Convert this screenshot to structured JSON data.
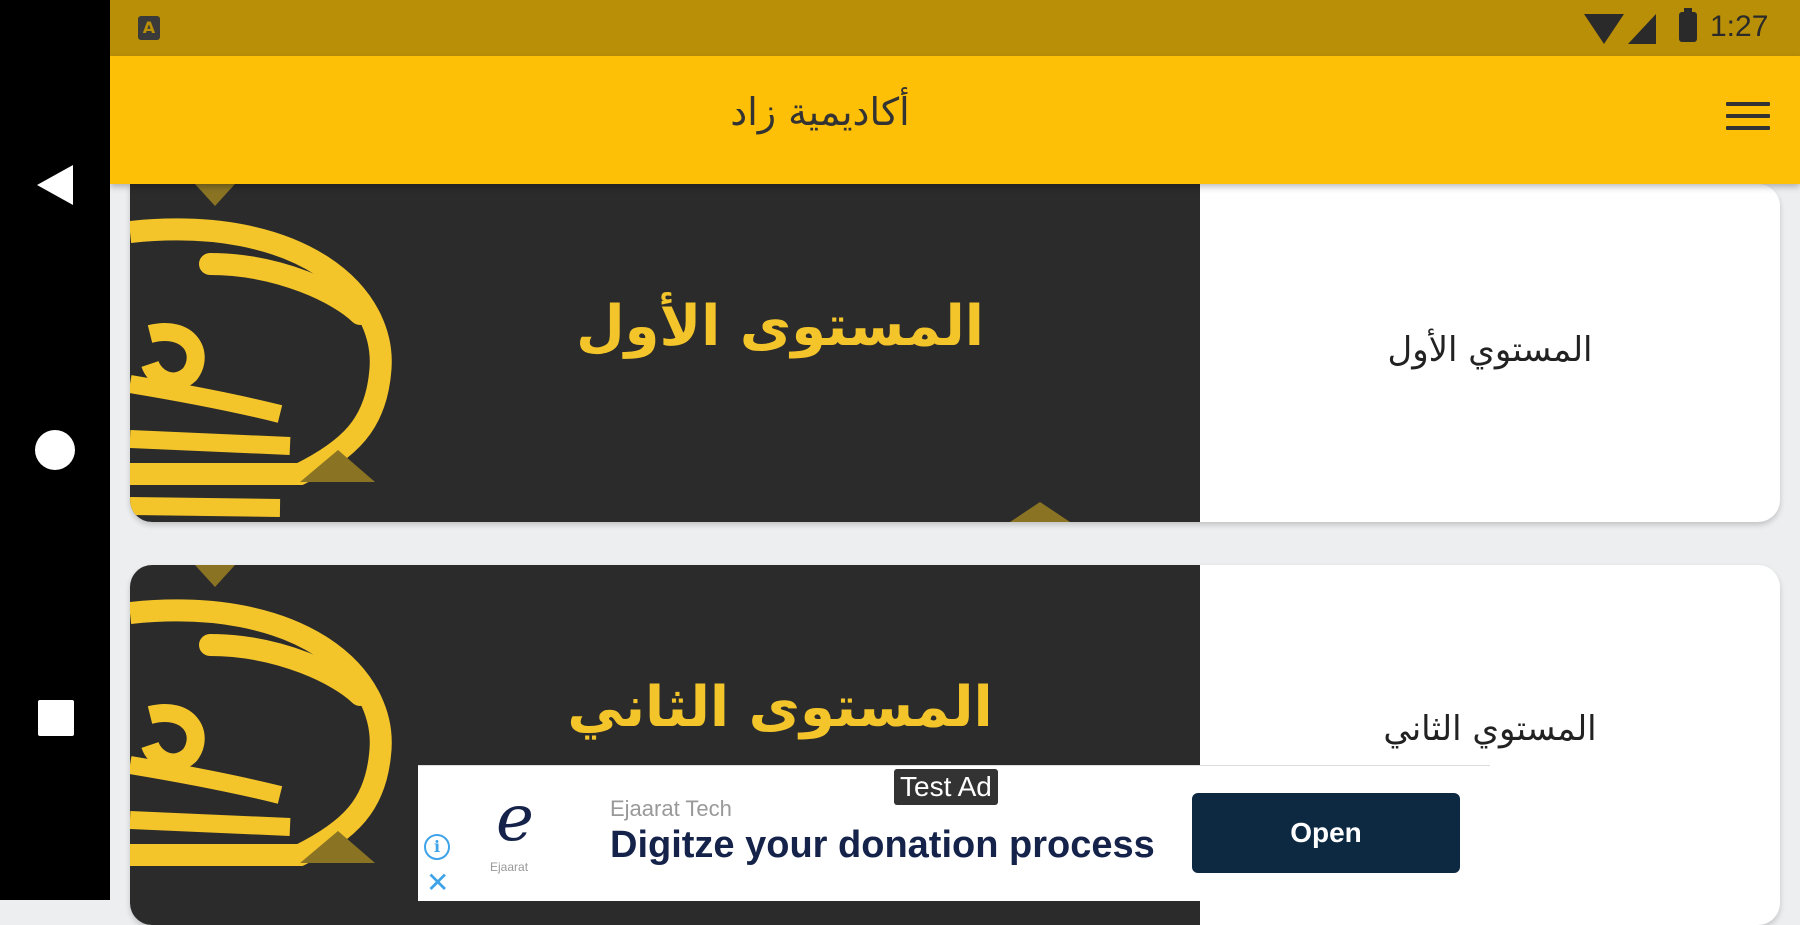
{
  "status_bar": {
    "notification_icon": "A",
    "time": "1:27",
    "icons": [
      "wifi-icon",
      "signal-icon",
      "battery-icon"
    ]
  },
  "nav_bar": {
    "buttons": [
      "back-icon",
      "home-icon",
      "recents-icon"
    ]
  },
  "app_bar": {
    "title": "أكاديمية زاد",
    "menu_icon": "menu-icon",
    "color": "#fdc007"
  },
  "cards": [
    {
      "image_text": "المستوى الأول",
      "label": "المستوي الأول"
    },
    {
      "image_text": "المستوى الثاني",
      "label": "المستوي الثاني"
    }
  ],
  "ad": {
    "badge": "Test Ad",
    "advertiser": "Ejaarat Tech",
    "logo_text": "Ejaarat",
    "headline": "Digitze your donation process",
    "button": "Open",
    "info_icon": "i",
    "close_icon": "✕"
  },
  "colors": {
    "accent": "#fdc007",
    "status_bar": "#b98f08",
    "banner_dark": "#2b2b2b",
    "banner_gold": "#f4c52a",
    "ad_button": "#0d2942"
  }
}
